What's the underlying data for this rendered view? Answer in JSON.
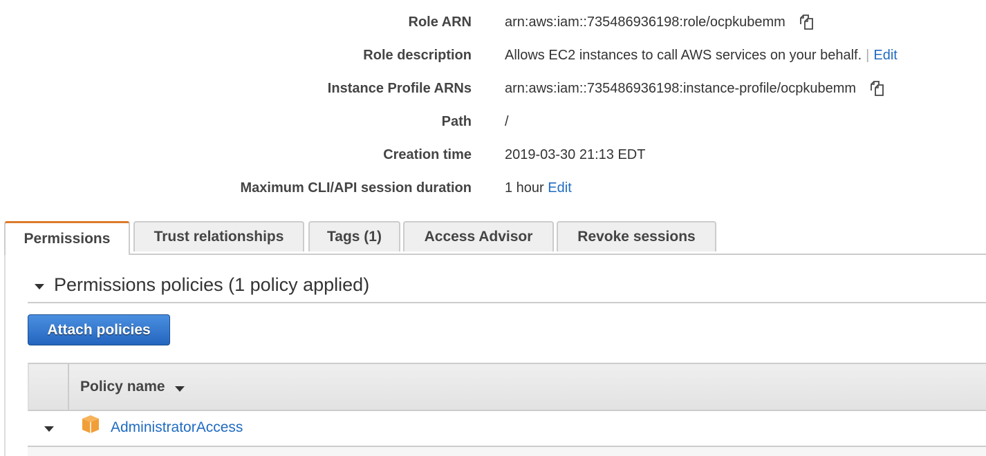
{
  "summary": {
    "role_arn": {
      "label": "Role ARN",
      "value": "arn:aws:iam::735486936198:role/ocpkubemm"
    },
    "role_description": {
      "label": "Role description",
      "value": "Allows EC2 instances to call AWS services on your behalf.",
      "separator": "|",
      "edit": "Edit"
    },
    "instance_profile": {
      "label": "Instance Profile ARNs",
      "value": "arn:aws:iam::735486936198:instance-profile/ocpkubemm"
    },
    "path": {
      "label": "Path",
      "value": "/"
    },
    "creation_time": {
      "label": "Creation time",
      "value": "2019-03-30 21:13 EDT"
    },
    "session_duration": {
      "label": "Maximum CLI/API session duration",
      "value": "1 hour",
      "edit": "Edit"
    }
  },
  "tabs": [
    {
      "label": "Permissions",
      "active": true
    },
    {
      "label": "Trust relationships"
    },
    {
      "label": "Tags (1)"
    },
    {
      "label": "Access Advisor"
    },
    {
      "label": "Revoke sessions"
    }
  ],
  "permissions": {
    "section_title": "Permissions policies (1 policy applied)",
    "attach_button": "Attach policies",
    "table": {
      "column_header": "Policy name",
      "rows": [
        {
          "name": "AdministratorAccess",
          "icon": "aws-managed-policy-cube-icon"
        }
      ]
    }
  },
  "colors": {
    "link": "#1f6bc1",
    "active_tab_accent": "#dd7a2b",
    "primary_button": "#2465bf",
    "policy_icon": "#f19e38"
  }
}
